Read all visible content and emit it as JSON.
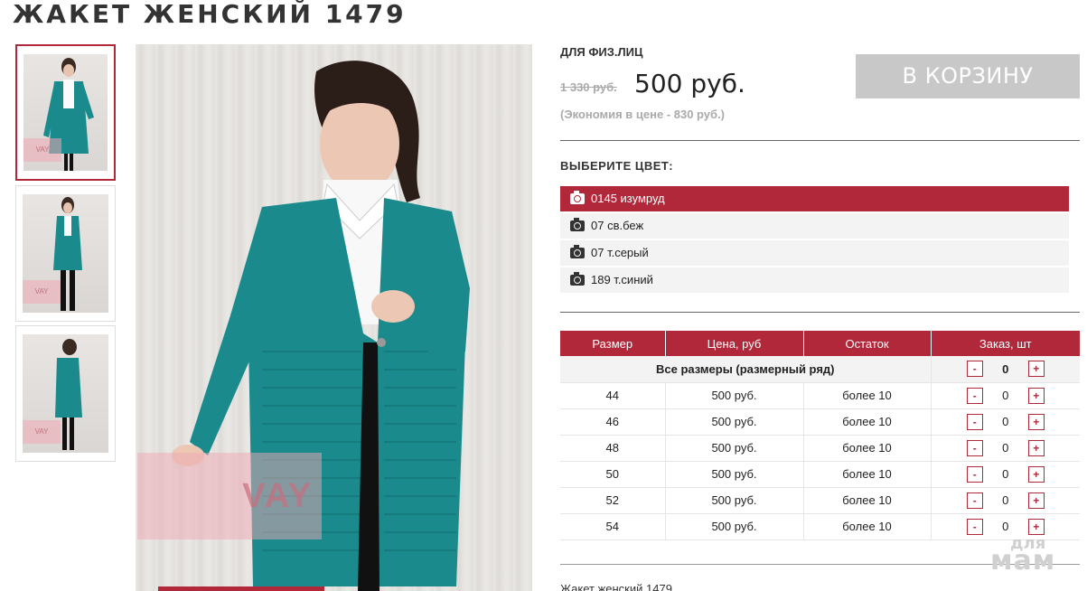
{
  "product": {
    "title": "ЖАКЕТ ЖЕНСКИЙ 1479",
    "audience": "ДЛЯ ФИЗ.ЛИЦ",
    "old_price": "1 330 руб.",
    "price": "500 руб.",
    "economy": "(Экономия в цене - 830 руб.)",
    "cart_label": "В КОРЗИНУ",
    "description": "Жакет женский 1479"
  },
  "gallery": {
    "watermark": "VAY",
    "thumbs": [
      {
        "label": "VAY"
      },
      {
        "label": "VAY"
      },
      {
        "label": "VAY"
      }
    ]
  },
  "colors": {
    "label": "ВЫБЕРИТЕ ЦВЕТ:",
    "items": [
      {
        "name": "0145 изумруд",
        "selected": true
      },
      {
        "name": "07 св.беж",
        "selected": false
      },
      {
        "name": "07 т.серый",
        "selected": false
      },
      {
        "name": "189 т.синий",
        "selected": false
      }
    ]
  },
  "table": {
    "headers": [
      "Размер",
      "Цена, руб",
      "Остаток",
      "Заказ, шт"
    ],
    "all_sizes_label": "Все размеры (размерный ряд)",
    "all_sizes_qty": "0",
    "rows": [
      {
        "size": "44",
        "price": "500 руб.",
        "stock": "более 10",
        "qty": "0"
      },
      {
        "size": "46",
        "price": "500 руб.",
        "stock": "более 10",
        "qty": "0"
      },
      {
        "size": "48",
        "price": "500 руб.",
        "stock": "более 10",
        "qty": "0"
      },
      {
        "size": "50",
        "price": "500 руб.",
        "stock": "более 10",
        "qty": "0"
      },
      {
        "size": "52",
        "price": "500 руб.",
        "stock": "более 10",
        "qty": "0"
      },
      {
        "size": "54",
        "price": "500 руб.",
        "stock": "более 10",
        "qty": "0"
      }
    ],
    "minus": "-",
    "plus": "+"
  },
  "site_watermark": {
    "top": "для",
    "bottom": "мам"
  },
  "colors_theme": {
    "accent": "#b0283a",
    "cart_button": "#c8c8c8",
    "cardigan": "#1a8a8c"
  }
}
